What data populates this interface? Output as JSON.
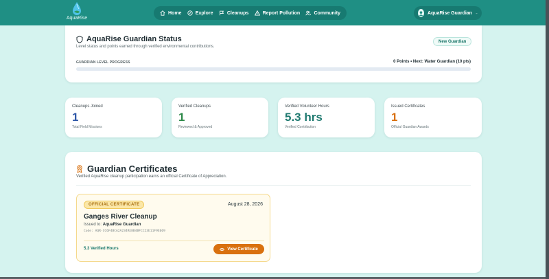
{
  "brand": {
    "name": "AquaRise",
    "color": "#1f8f84"
  },
  "nav": {
    "items": [
      {
        "label": "Home",
        "icon": "home-icon"
      },
      {
        "label": "Explore",
        "icon": "compass-icon"
      },
      {
        "label": "Cleanups",
        "icon": "flag-icon"
      },
      {
        "label": "Report Pollution",
        "icon": "warning-icon"
      },
      {
        "label": "Community",
        "icon": "users-icon"
      }
    ]
  },
  "user": {
    "name": "AquaRise Guardian",
    "icon": "avatar-icon"
  },
  "status": {
    "title": "AquaRise Guardian Status",
    "subtitle": "Level status and points earned through verified environmental contributions.",
    "badge": "New Guardian",
    "progress_label": "GUARDIAN LEVEL PROGRESS",
    "progress_value": "0 Points • Next: Water Guardian (10 pts)",
    "progress_fraction": 0.0,
    "icon": "shield-icon"
  },
  "stats": [
    {
      "label": "Cleanups Joined",
      "value": "1",
      "sub": "Total Field Missions",
      "color": "#2f58a8"
    },
    {
      "label": "Verified Cleanups",
      "value": "1",
      "sub": "Reviewed & Approved",
      "color": "#2f8a4a"
    },
    {
      "label": "Verified Volunteer Hours",
      "value": "5.3 hrs",
      "sub": "Verified Contribution",
      "color": "#1f7a70"
    },
    {
      "label": "Issued Certificates",
      "value": "1",
      "sub": "Official Guardian Awards",
      "color": "#d9700e"
    }
  ],
  "certificates": {
    "title": "Guardian Certificates",
    "subtitle": "Verified AquaRise cleanup participation earns an official Certificate of Appreciation.",
    "icon": "award-icon",
    "items": [
      {
        "tag": "OFFICIAL CERTIFICATE",
        "date": "August 28, 2026",
        "title": "Ganges River Cleanup",
        "issued_label": "Issued to:",
        "issued_to": "AquaRise Guardian",
        "code": "Code: AQR-CC6F4BCA2A234RE8B4BFCC23E11F9E669",
        "hours": "5.3 Verified Hours",
        "button": "View Certificate"
      }
    ]
  }
}
